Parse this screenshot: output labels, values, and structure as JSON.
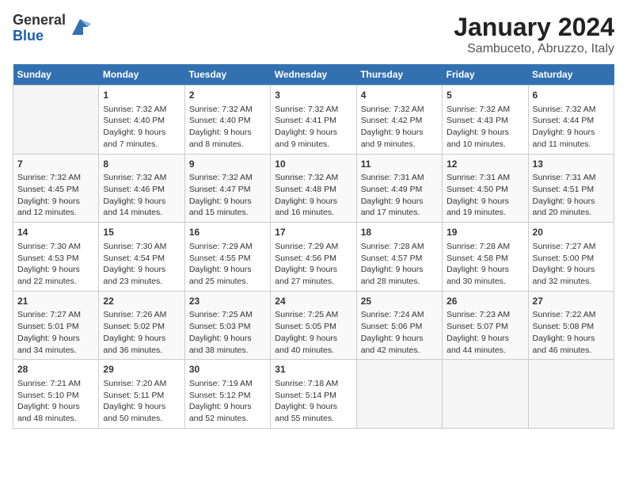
{
  "header": {
    "logo": {
      "general": "General",
      "blue": "Blue"
    },
    "title": "January 2024",
    "location": "Sambuceto, Abruzzo, Italy"
  },
  "days_of_week": [
    "Sunday",
    "Monday",
    "Tuesday",
    "Wednesday",
    "Thursday",
    "Friday",
    "Saturday"
  ],
  "weeks": [
    [
      {
        "day": "",
        "sunrise": "",
        "sunset": "",
        "daylight": ""
      },
      {
        "day": "1",
        "sunrise": "Sunrise: 7:32 AM",
        "sunset": "Sunset: 4:40 PM",
        "daylight": "Daylight: 9 hours and 7 minutes."
      },
      {
        "day": "2",
        "sunrise": "Sunrise: 7:32 AM",
        "sunset": "Sunset: 4:40 PM",
        "daylight": "Daylight: 9 hours and 8 minutes."
      },
      {
        "day": "3",
        "sunrise": "Sunrise: 7:32 AM",
        "sunset": "Sunset: 4:41 PM",
        "daylight": "Daylight: 9 hours and 9 minutes."
      },
      {
        "day": "4",
        "sunrise": "Sunrise: 7:32 AM",
        "sunset": "Sunset: 4:42 PM",
        "daylight": "Daylight: 9 hours and 9 minutes."
      },
      {
        "day": "5",
        "sunrise": "Sunrise: 7:32 AM",
        "sunset": "Sunset: 4:43 PM",
        "daylight": "Daylight: 9 hours and 10 minutes."
      },
      {
        "day": "6",
        "sunrise": "Sunrise: 7:32 AM",
        "sunset": "Sunset: 4:44 PM",
        "daylight": "Daylight: 9 hours and 11 minutes."
      }
    ],
    [
      {
        "day": "7",
        "sunrise": "Sunrise: 7:32 AM",
        "sunset": "Sunset: 4:45 PM",
        "daylight": "Daylight: 9 hours and 12 minutes."
      },
      {
        "day": "8",
        "sunrise": "Sunrise: 7:32 AM",
        "sunset": "Sunset: 4:46 PM",
        "daylight": "Daylight: 9 hours and 14 minutes."
      },
      {
        "day": "9",
        "sunrise": "Sunrise: 7:32 AM",
        "sunset": "Sunset: 4:47 PM",
        "daylight": "Daylight: 9 hours and 15 minutes."
      },
      {
        "day": "10",
        "sunrise": "Sunrise: 7:32 AM",
        "sunset": "Sunset: 4:48 PM",
        "daylight": "Daylight: 9 hours and 16 minutes."
      },
      {
        "day": "11",
        "sunrise": "Sunrise: 7:31 AM",
        "sunset": "Sunset: 4:49 PM",
        "daylight": "Daylight: 9 hours and 17 minutes."
      },
      {
        "day": "12",
        "sunrise": "Sunrise: 7:31 AM",
        "sunset": "Sunset: 4:50 PM",
        "daylight": "Daylight: 9 hours and 19 minutes."
      },
      {
        "day": "13",
        "sunrise": "Sunrise: 7:31 AM",
        "sunset": "Sunset: 4:51 PM",
        "daylight": "Daylight: 9 hours and 20 minutes."
      }
    ],
    [
      {
        "day": "14",
        "sunrise": "Sunrise: 7:30 AM",
        "sunset": "Sunset: 4:53 PM",
        "daylight": "Daylight: 9 hours and 22 minutes."
      },
      {
        "day": "15",
        "sunrise": "Sunrise: 7:30 AM",
        "sunset": "Sunset: 4:54 PM",
        "daylight": "Daylight: 9 hours and 23 minutes."
      },
      {
        "day": "16",
        "sunrise": "Sunrise: 7:29 AM",
        "sunset": "Sunset: 4:55 PM",
        "daylight": "Daylight: 9 hours and 25 minutes."
      },
      {
        "day": "17",
        "sunrise": "Sunrise: 7:29 AM",
        "sunset": "Sunset: 4:56 PM",
        "daylight": "Daylight: 9 hours and 27 minutes."
      },
      {
        "day": "18",
        "sunrise": "Sunrise: 7:28 AM",
        "sunset": "Sunset: 4:57 PM",
        "daylight": "Daylight: 9 hours and 28 minutes."
      },
      {
        "day": "19",
        "sunrise": "Sunrise: 7:28 AM",
        "sunset": "Sunset: 4:58 PM",
        "daylight": "Daylight: 9 hours and 30 minutes."
      },
      {
        "day": "20",
        "sunrise": "Sunrise: 7:27 AM",
        "sunset": "Sunset: 5:00 PM",
        "daylight": "Daylight: 9 hours and 32 minutes."
      }
    ],
    [
      {
        "day": "21",
        "sunrise": "Sunrise: 7:27 AM",
        "sunset": "Sunset: 5:01 PM",
        "daylight": "Daylight: 9 hours and 34 minutes."
      },
      {
        "day": "22",
        "sunrise": "Sunrise: 7:26 AM",
        "sunset": "Sunset: 5:02 PM",
        "daylight": "Daylight: 9 hours and 36 minutes."
      },
      {
        "day": "23",
        "sunrise": "Sunrise: 7:25 AM",
        "sunset": "Sunset: 5:03 PM",
        "daylight": "Daylight: 9 hours and 38 minutes."
      },
      {
        "day": "24",
        "sunrise": "Sunrise: 7:25 AM",
        "sunset": "Sunset: 5:05 PM",
        "daylight": "Daylight: 9 hours and 40 minutes."
      },
      {
        "day": "25",
        "sunrise": "Sunrise: 7:24 AM",
        "sunset": "Sunset: 5:06 PM",
        "daylight": "Daylight: 9 hours and 42 minutes."
      },
      {
        "day": "26",
        "sunrise": "Sunrise: 7:23 AM",
        "sunset": "Sunset: 5:07 PM",
        "daylight": "Daylight: 9 hours and 44 minutes."
      },
      {
        "day": "27",
        "sunrise": "Sunrise: 7:22 AM",
        "sunset": "Sunset: 5:08 PM",
        "daylight": "Daylight: 9 hours and 46 minutes."
      }
    ],
    [
      {
        "day": "28",
        "sunrise": "Sunrise: 7:21 AM",
        "sunset": "Sunset: 5:10 PM",
        "daylight": "Daylight: 9 hours and 48 minutes."
      },
      {
        "day": "29",
        "sunrise": "Sunrise: 7:20 AM",
        "sunset": "Sunset: 5:11 PM",
        "daylight": "Daylight: 9 hours and 50 minutes."
      },
      {
        "day": "30",
        "sunrise": "Sunrise: 7:19 AM",
        "sunset": "Sunset: 5:12 PM",
        "daylight": "Daylight: 9 hours and 52 minutes."
      },
      {
        "day": "31",
        "sunrise": "Sunrise: 7:18 AM",
        "sunset": "Sunset: 5:14 PM",
        "daylight": "Daylight: 9 hours and 55 minutes."
      },
      {
        "day": "",
        "sunrise": "",
        "sunset": "",
        "daylight": ""
      },
      {
        "day": "",
        "sunrise": "",
        "sunset": "",
        "daylight": ""
      },
      {
        "day": "",
        "sunrise": "",
        "sunset": "",
        "daylight": ""
      }
    ]
  ]
}
